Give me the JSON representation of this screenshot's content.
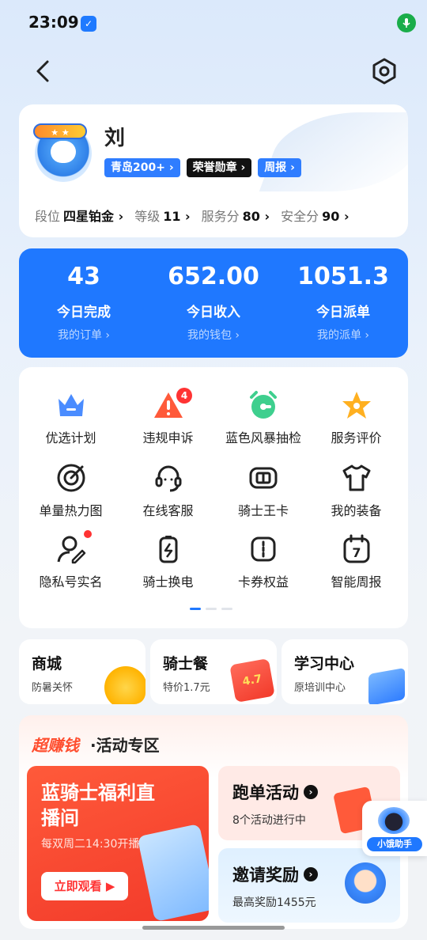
{
  "status_bar": {
    "time": "23:09"
  },
  "profile": {
    "name": "刘",
    "tags": [
      "青岛200+ ›",
      "荣誉勋章 ›",
      "周报 ›"
    ],
    "stats": [
      {
        "label": "段位",
        "value": "四星铂金 ›"
      },
      {
        "label": "等级",
        "value": "11 ›"
      },
      {
        "label": "服务分",
        "value": "80 ›"
      },
      {
        "label": "安全分",
        "value": "90 ›"
      }
    ]
  },
  "kpis": [
    {
      "value": "43",
      "label": "今日完成",
      "link": "我的订单 ›"
    },
    {
      "value": "652.00",
      "label": "今日收入",
      "link": "我的钱包 ›"
    },
    {
      "value": "1051.3",
      "label": "今日派单",
      "link": "我的派单 ›"
    }
  ],
  "grid": [
    {
      "label": "优选计划",
      "icon": "crown-icon"
    },
    {
      "label": "违规申诉",
      "icon": "warning-icon",
      "badge": "4"
    },
    {
      "label": "蓝色风暴抽检",
      "icon": "alarm-clock-icon"
    },
    {
      "label": "服务评价",
      "icon": "star-icon"
    },
    {
      "label": "单量热力图",
      "icon": "target-icon"
    },
    {
      "label": "在线客服",
      "icon": "headset-icon"
    },
    {
      "label": "骑士王卡",
      "icon": "card-icon"
    },
    {
      "label": "我的装备",
      "icon": "shirt-icon"
    },
    {
      "label": "隐私号实名",
      "icon": "user-edit-icon"
    },
    {
      "label": "骑士换电",
      "icon": "battery-icon"
    },
    {
      "label": "卡券权益",
      "icon": "coupon-icon"
    },
    {
      "label": "智能周报",
      "icon": "calendar-icon",
      "day": "7"
    }
  ],
  "shortcuts": [
    {
      "title": "商城",
      "sub": "防暑关怀"
    },
    {
      "title": "骑士餐",
      "sub": "特价1.7元",
      "deco": "4.7"
    },
    {
      "title": "学习中心",
      "sub": "原培训中心"
    }
  ],
  "activity": {
    "title_highlight": "超赚钱",
    "title": "·活动专区",
    "live": {
      "title": "蓝骑士福利直播间",
      "sub": "每双周二14:30开播",
      "button": "立即观看 ▶"
    },
    "run": {
      "title": "跑单活动",
      "desc": "8个活动进行中"
    },
    "invite": {
      "title": "邀请奖励",
      "desc": "最高奖励1455元"
    }
  },
  "assistant": {
    "label": "小饿助手"
  },
  "colors": {
    "primary": "#1f78ff",
    "danger": "#ff3333",
    "accent_orange": "#ff4d2e"
  }
}
